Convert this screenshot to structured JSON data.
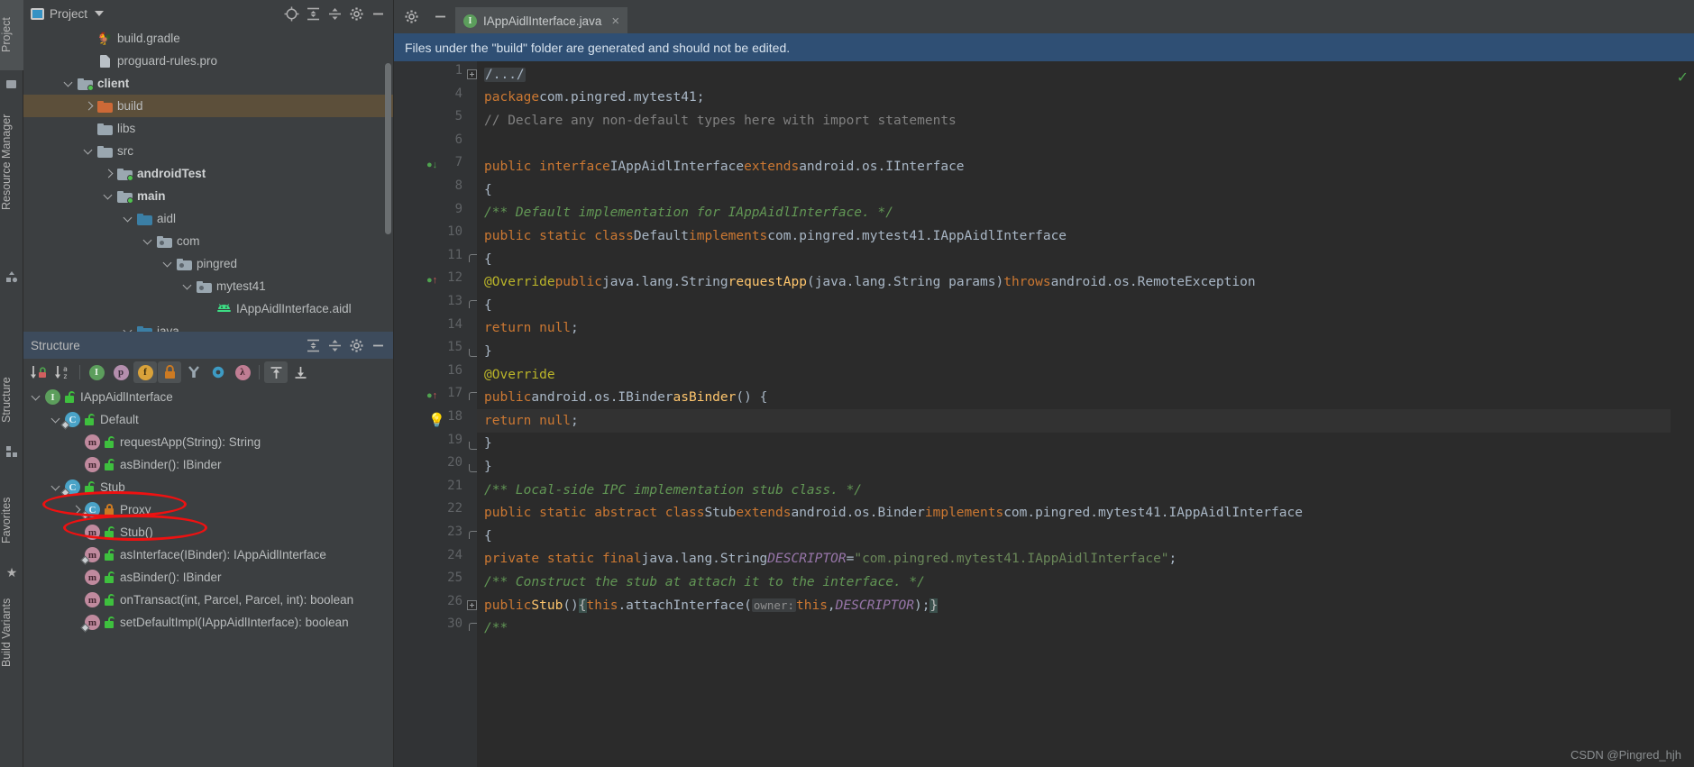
{
  "toolwindows": {
    "left": [
      {
        "label": "Project",
        "icon": "project-icon",
        "selected": true
      },
      {
        "label": "Resource Manager",
        "icon": "resource-icon",
        "selected": false
      }
    ],
    "leftlower": [
      {
        "label": "Structure",
        "icon": "structure-icon"
      },
      {
        "label": "Favorites",
        "icon": "star-icon"
      },
      {
        "label": "Build Variants",
        "icon": "variants-icon"
      }
    ]
  },
  "project_panel": {
    "title": "Project",
    "dropdown": "chevron-down-icon",
    "actions": [
      "locate-icon",
      "expand-all-icon",
      "collapse-all-icon",
      "settings-icon",
      "hide-icon"
    ],
    "tree": [
      {
        "label": "build.gradle",
        "indent": 2,
        "arrow": "none",
        "icon": "gradle-file",
        "bold": false,
        "selected": false
      },
      {
        "label": "proguard-rules.pro",
        "indent": 2,
        "arrow": "none",
        "icon": "text-file",
        "bold": false,
        "selected": false
      },
      {
        "label": "client",
        "indent": 1,
        "arrow": "down",
        "icon": "module-folder",
        "bold": true,
        "selected": false
      },
      {
        "label": "build",
        "indent": 2,
        "arrow": "right",
        "icon": "orange-folder",
        "bold": false,
        "selected": true
      },
      {
        "label": "libs",
        "indent": 2,
        "arrow": "none",
        "icon": "gray-folder",
        "bold": false,
        "selected": false
      },
      {
        "label": "src",
        "indent": 2,
        "arrow": "down",
        "icon": "gray-folder",
        "bold": false,
        "selected": false
      },
      {
        "label": "androidTest",
        "indent": 3,
        "arrow": "right",
        "icon": "module-folder",
        "bold": true,
        "selected": false
      },
      {
        "label": "main",
        "indent": 3,
        "arrow": "down",
        "icon": "module-folder",
        "bold": true,
        "selected": false
      },
      {
        "label": "aidl",
        "indent": 4,
        "arrow": "down",
        "icon": "blue-folder",
        "bold": false,
        "selected": false
      },
      {
        "label": "com",
        "indent": 5,
        "arrow": "down",
        "icon": "package-folder",
        "bold": false,
        "selected": false
      },
      {
        "label": "pingred",
        "indent": 6,
        "arrow": "down",
        "icon": "package-folder",
        "bold": false,
        "selected": false
      },
      {
        "label": "mytest41",
        "indent": 7,
        "arrow": "down",
        "icon": "package-folder",
        "bold": false,
        "selected": false
      },
      {
        "label": "IAppAidlInterface.aidl",
        "indent": 8,
        "arrow": "none",
        "icon": "android-file",
        "bold": false,
        "selected": false
      },
      {
        "label": "java",
        "indent": 4,
        "arrow": "down",
        "icon": "blue-folder",
        "bold": false,
        "selected": false
      }
    ]
  },
  "structure_panel": {
    "title": "Structure",
    "actions": [
      "expand-all-icon",
      "collapse-all-icon",
      "settings-icon",
      "hide-icon"
    ],
    "toolbar": [
      {
        "name": "sort-by-visibility-icon",
        "glyph": "↓",
        "sub": "lock",
        "active": false
      },
      {
        "name": "sort-alphabetically-icon",
        "glyph": "↓",
        "sub": "az",
        "active": false
      },
      {
        "name": "show-inherited-icon",
        "glyph": "I",
        "color": "#5c9e5c",
        "active": false
      },
      {
        "name": "show-properties-icon",
        "glyph": "p",
        "color": "#b48ead",
        "active": false
      },
      {
        "name": "show-fields-icon",
        "glyph": "f",
        "color": "#d9a23a",
        "active": true
      },
      {
        "name": "show-non-public-icon",
        "glyph": "■",
        "color": "#cc7a22",
        "active": true
      },
      {
        "name": "group-methods-icon",
        "glyph": "Y",
        "color": "#9aa7b0",
        "active": false
      },
      {
        "name": "show-anonymous-icon",
        "glyph": "O",
        "color": "#3d9bc4",
        "active": false
      },
      {
        "name": "show-lambdas-icon",
        "glyph": "λ",
        "color": "#c07d93",
        "active": false
      },
      {
        "name": "autoscroll-from-source-icon",
        "glyph": "⤒",
        "active": true
      },
      {
        "name": "autoscroll-to-source-icon",
        "glyph": "⤓",
        "active": false
      }
    ],
    "tree": [
      {
        "label": "IAppAidlInterface",
        "indent": 0,
        "arrow": "down",
        "icon": "interface",
        "lock": "green",
        "circled": false
      },
      {
        "label": "Default",
        "indent": 1,
        "arrow": "down",
        "icon": "class-inner",
        "lock": "green",
        "circled": false
      },
      {
        "label": "requestApp(String): String",
        "indent": 2,
        "arrow": "none",
        "icon": "method",
        "lock": "green",
        "circled": false
      },
      {
        "label": "asBinder(): IBinder",
        "indent": 2,
        "arrow": "none",
        "icon": "method",
        "lock": "green",
        "circled": false
      },
      {
        "label": "Stub",
        "indent": 1,
        "arrow": "down",
        "icon": "class-inner",
        "lock": "green",
        "circled": true
      },
      {
        "label": "Proxy",
        "indent": 2,
        "arrow": "right",
        "icon": "class-inner",
        "lock": "orange",
        "circled": true
      },
      {
        "label": "Stub()",
        "indent": 2,
        "arrow": "none",
        "icon": "method",
        "lock": "green",
        "circled": false
      },
      {
        "label": "asInterface(IBinder): IAppAidlInterface",
        "indent": 2,
        "arrow": "none",
        "icon": "method-st",
        "lock": "green",
        "circled": false
      },
      {
        "label": "asBinder(): IBinder",
        "indent": 2,
        "arrow": "none",
        "icon": "method",
        "lock": "green",
        "circled": false
      },
      {
        "label": "onTransact(int, Parcel, Parcel, int): boolean",
        "indent": 2,
        "arrow": "none",
        "icon": "method",
        "lock": "green",
        "circled": false
      },
      {
        "label": "setDefaultImpl(IAppAidlInterface): boolean",
        "indent": 2,
        "arrow": "none",
        "icon": "method-st",
        "lock": "green",
        "circled": false
      }
    ]
  },
  "editor": {
    "tab": {
      "label": "IAppAidlInterface.java",
      "icon": "interface-icon",
      "close": "×"
    },
    "toolbar": [
      "settings-icon",
      "hide-icon"
    ],
    "notification": "Files under the \"build\" folder are generated and should not be edited.",
    "inspection_status": "✓",
    "lines": [
      {
        "num": "1",
        "fold": "plus",
        "html": "<span class=\"foldph\">/...&#47;</span>"
      },
      {
        "num": "4",
        "fold": "",
        "html": "<span class=\"kw\">package</span> <span class=\"ty\">com.pingred.mytest41;</span>"
      },
      {
        "num": "5",
        "fold": "",
        "html": "<span class=\"lc\">// Declare any non-default types here with import statements</span>"
      },
      {
        "num": "6",
        "fold": "",
        "html": ""
      },
      {
        "num": "7",
        "fold": "",
        "gutmark": "impl",
        "html": "<span class=\"kw\">public interface</span> <span class=\"ty\">IAppAidlInterface</span> <span class=\"kw\">extends</span> <span class=\"ty\">android.os.IInterface</span>"
      },
      {
        "num": "8",
        "fold": "",
        "html": "<span class=\"ty\">{</span>"
      },
      {
        "num": "9",
        "fold": "",
        "html": "  <span class=\"cm\">/** Default implementation for IAppAidlInterface. */</span>"
      },
      {
        "num": "10",
        "fold": "",
        "html": "  <span class=\"kw\">public static class</span> <span class=\"ty\">Default</span> <span class=\"kw\">implements</span> <span class=\"ty\">com.pingred.mytest41.IAppAidlInterface</span>"
      },
      {
        "num": "11",
        "fold": "bracetop",
        "html": "  <span class=\"ty\">{</span>"
      },
      {
        "num": "12",
        "fold": "",
        "gutmark": "override",
        "html": "    <span class=\"an\">@Override</span> <span class=\"kw\">public</span> <span class=\"ty\">java.lang.String</span> <span class=\"mn\">requestApp</span><span class=\"ty\">(java.lang.String params)</span> <span class=\"kw\">throws</span> <span class=\"ty\">android.os.RemoteException</span>"
      },
      {
        "num": "13",
        "fold": "bracetop",
        "html": "    <span class=\"ty\">{</span>"
      },
      {
        "num": "14",
        "fold": "",
        "html": "      <span class=\"kw\">return null</span><span class=\"ty\">;</span>"
      },
      {
        "num": "15",
        "fold": "bracebot",
        "html": "    <span class=\"ty\">}</span>"
      },
      {
        "num": "16",
        "fold": "",
        "html": "    <span class=\"an\">@Override</span>"
      },
      {
        "num": "17",
        "fold": "bracetop",
        "gutmark": "override",
        "html": "    <span class=\"kw\">public</span> <span class=\"ty\">android.os.IBinder</span> <span class=\"mn\">asBinder</span><span class=\"ty\">() {</span>"
      },
      {
        "num": "18",
        "fold": "",
        "bulb": true,
        "caret": true,
        "html": "      <span class=\"kw\">return null</span><span class=\"ty\">;</span>"
      },
      {
        "num": "19",
        "fold": "bracebot",
        "html": "    <span class=\"ty\">}</span>"
      },
      {
        "num": "20",
        "fold": "bracebot",
        "html": "  <span class=\"ty\">}</span>"
      },
      {
        "num": "21",
        "fold": "",
        "html": "  <span class=\"cm\">/** Local-side IPC implementation stub class. */</span>"
      },
      {
        "num": "22",
        "fold": "",
        "html": "  <span class=\"kw\">public static abstract class</span> <span class=\"ty\">Stub</span> <span class=\"kw\">extends</span> <span class=\"ty\">android.os.Binder</span> <span class=\"kw\">implements</span> <span class=\"ty\">com.pingred.mytest41.IAppAidlInterface</span>"
      },
      {
        "num": "23",
        "fold": "bracetop",
        "html": "  <span class=\"ty\">{</span>"
      },
      {
        "num": "24",
        "fold": "",
        "html": "    <span class=\"kw\">private static final</span> <span class=\"ty\">java.lang.String</span> <span class=\"fld\">DESCRIPTOR</span> <span class=\"ty\">=</span> <span class=\"st\">\"com.pingred.mytest41.IAppAidlInterface\"</span><span class=\"ty\">;</span>"
      },
      {
        "num": "25",
        "fold": "",
        "html": "    <span class=\"cm\">/** Construct the stub at attach it to the interface. */</span>"
      },
      {
        "num": "26",
        "fold": "plus",
        "html": "    <span class=\"kw\">public</span> <span class=\"mn\">Stub</span><span class=\"ty\">()</span> <span class=\"bracehl\">{</span> <span class=\"kw\">this</span><span class=\"ty\">.attachInterface(</span> <span class=\"hint\">owner:</span> <span class=\"kw\">this</span><span class=\"ty\">,</span> <span class=\"fld\">DESCRIPTOR</span><span class=\"ty\">);</span> <span class=\"bracehl\">}</span>"
      },
      {
        "num": "30",
        "fold": "bracetop",
        "html": "    <span class=\"cm\">/**</span>"
      }
    ]
  },
  "watermark": "CSDN @Pingred_hjh"
}
